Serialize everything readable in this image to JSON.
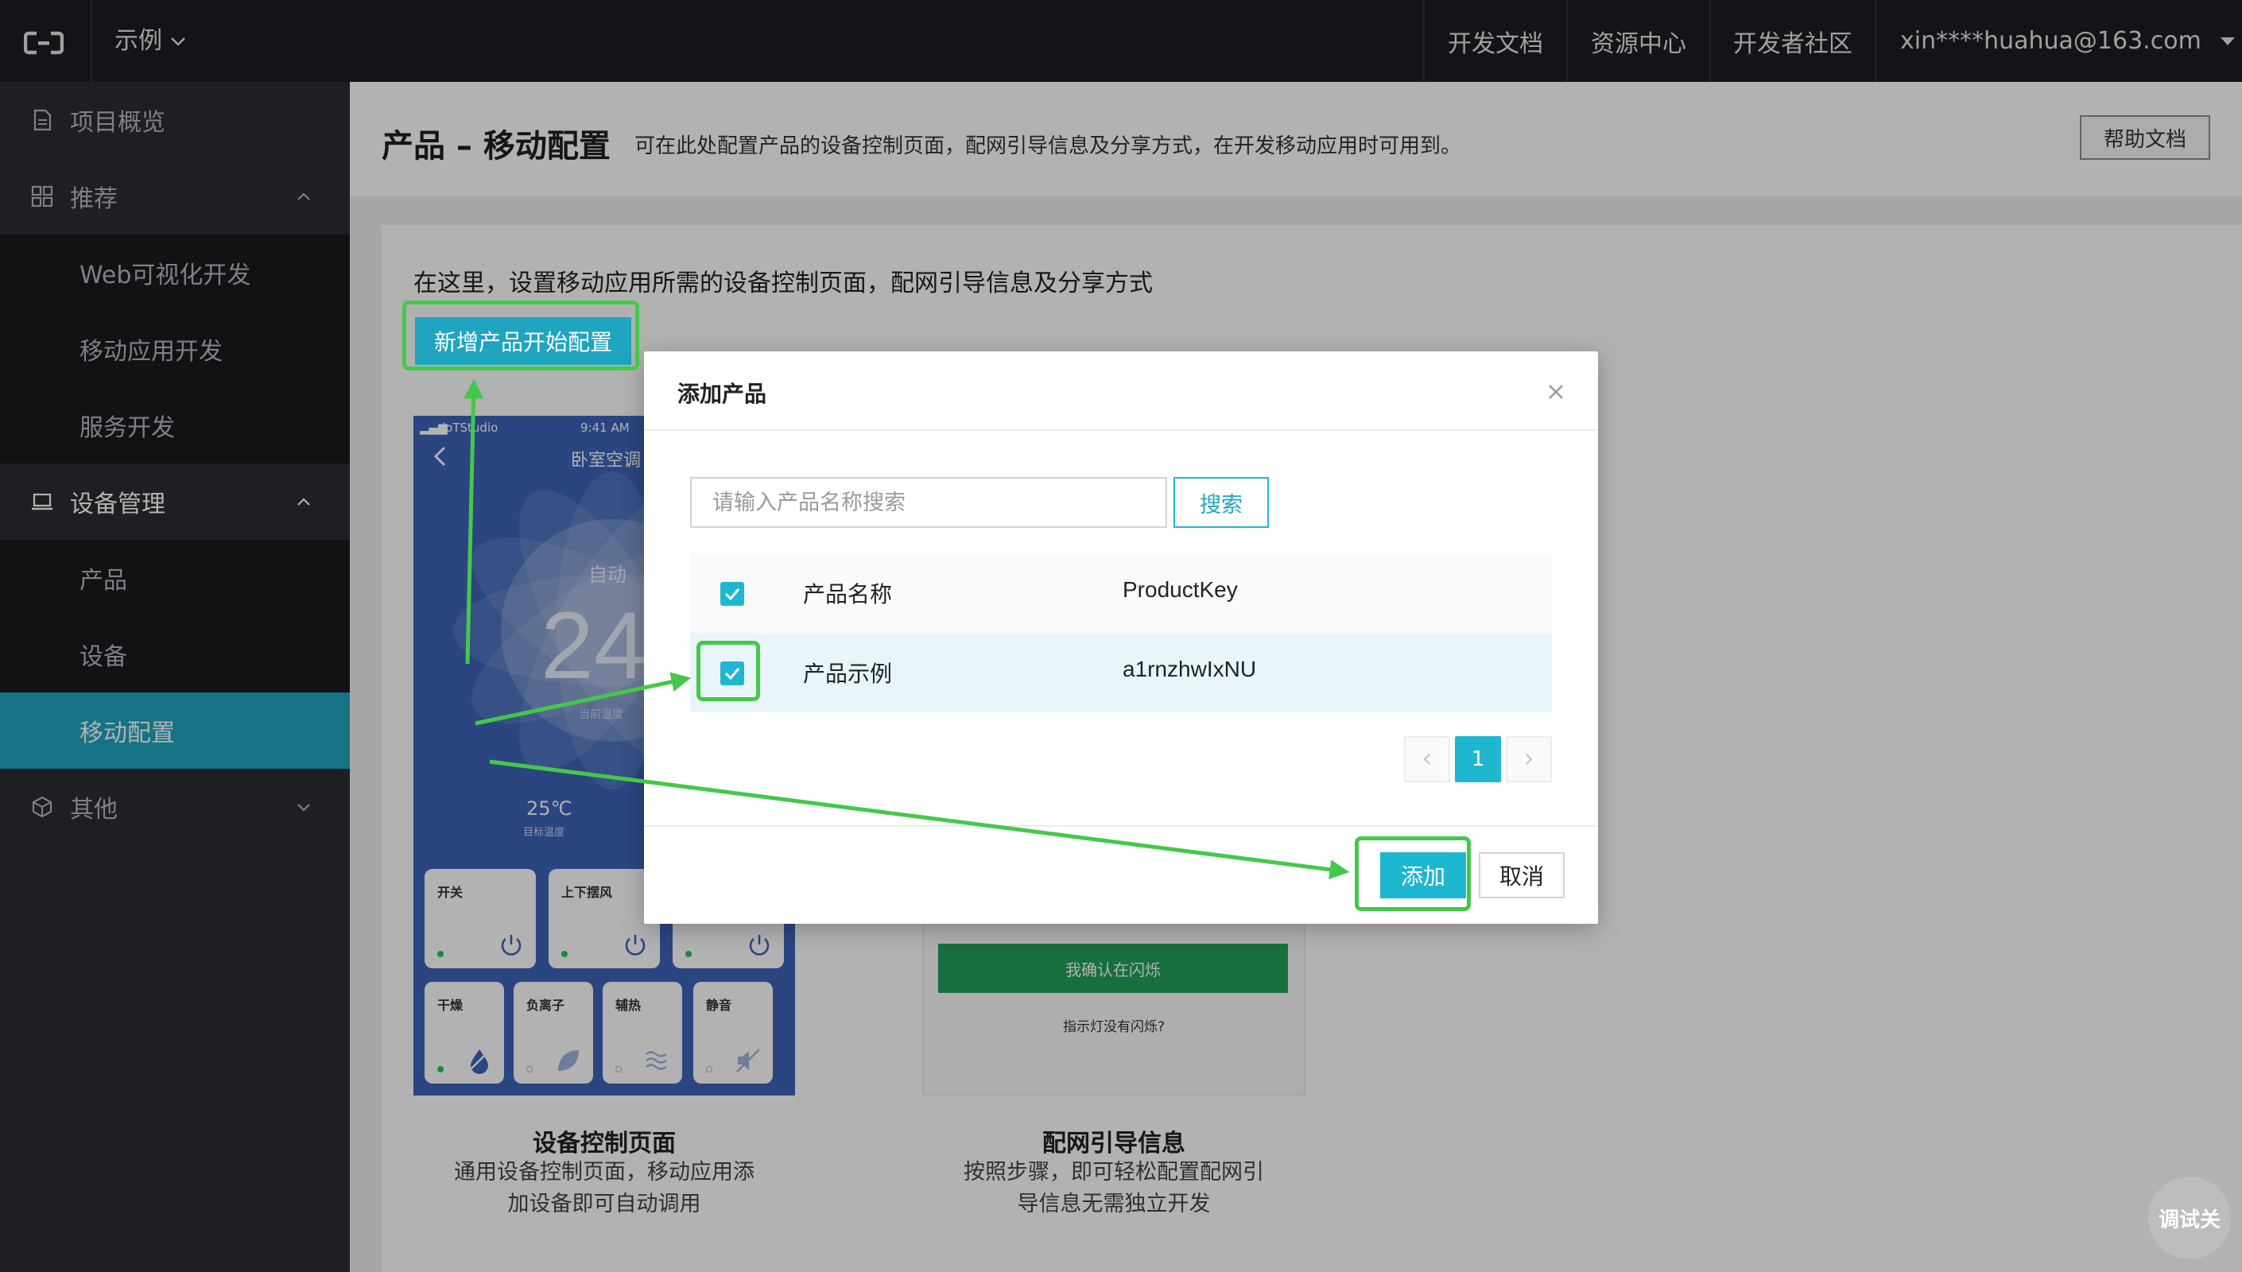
{
  "topbar": {
    "project": "示例",
    "nav": [
      "开发文档",
      "资源中心",
      "开发者社区"
    ],
    "user": "xin****huahua@163.com"
  },
  "sidebar": {
    "overview": "项目概览",
    "recommend": "推荐",
    "web_dev": "Web可视化开发",
    "mobile_dev": "移动应用开发",
    "service_dev": "服务开发",
    "device_mgmt": "设备管理",
    "product": "产品",
    "device": "设备",
    "mobile_config": "移动配置",
    "other": "其他"
  },
  "header": {
    "title": "产品 – 移动配置",
    "desc": "可在此处配置产品的设备控制页面，配网引导信息及分享方式，在开发移动应用时可用到。",
    "help": "帮助文档"
  },
  "content": {
    "intro": "在这里，设置移动应用所需的设备控制页面，配网引导信息及分享方式",
    "add_button": "新增产品开始配置",
    "phone": {
      "carrier": "ioTStudio",
      "time": "9:41 AM",
      "title": "卧室空调",
      "mode": "自动",
      "temp": "24",
      "current_label": "当前温度",
      "target_temp": "25℃",
      "target_label": "目标温度",
      "tiles": [
        "开关",
        "上下摆风",
        "",
        "干燥",
        "负离子",
        "辅热",
        "静音"
      ]
    },
    "guide": {
      "confirm": "我确认在闪烁",
      "no_blink": "指示灯没有闪烁?"
    },
    "feature_control": {
      "title": "设备控制页面",
      "desc1": "通用设备控制页面，移动应用添",
      "desc2": "加设备即可自动调用"
    },
    "feature_guide": {
      "title": "配网引导信息",
      "desc1": "按照步骤，即可轻松配置配网引",
      "desc2": "导信息无需独立开发"
    }
  },
  "modal": {
    "title": "添加产品",
    "search_placeholder": "请输入产品名称搜索",
    "search_button": "搜索",
    "columns": [
      "产品名称",
      "ProductKey"
    ],
    "rows": [
      {
        "name": "产品示例",
        "key": "a1rnzhwIxNU"
      }
    ],
    "page": "1",
    "add": "添加",
    "cancel": "取消"
  },
  "debug": "调试关",
  "colors": {
    "accent": "#1fb7cf",
    "sidebar_active": "#1fa5bf",
    "annotation": "#45c84a"
  }
}
